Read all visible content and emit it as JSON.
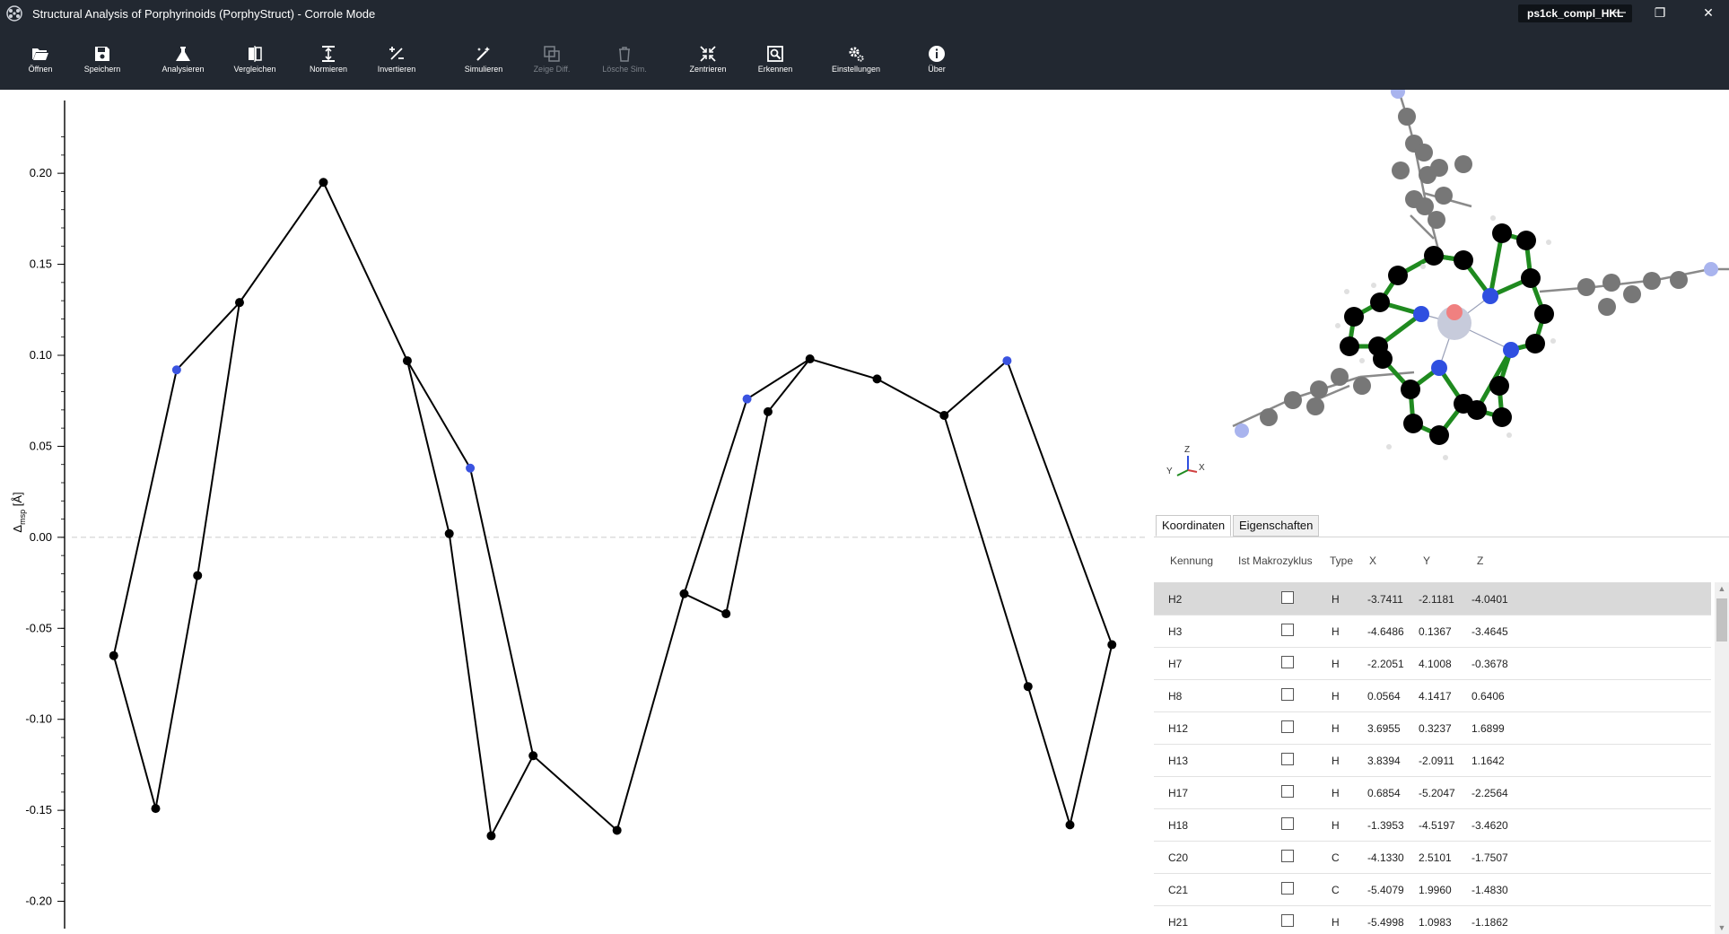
{
  "window": {
    "title": "Structural Analysis of Porphyrinoids (PorphyStruct) - Corrole Mode",
    "file_badge": "ps1ck_compl_HKL",
    "minimize": "—",
    "maximize": "❐",
    "close": "✕"
  },
  "toolbar": {
    "items": [
      {
        "label": "Öffnen",
        "icon": "folder-open-icon",
        "enabled": true
      },
      {
        "label": "Speichern",
        "icon": "save-icon",
        "enabled": true
      },
      {
        "label": "Analysieren",
        "icon": "flask-icon",
        "enabled": true
      },
      {
        "label": "Vergleichen",
        "icon": "compare-icon",
        "enabled": true
      },
      {
        "label": "Normieren",
        "icon": "normalize-icon",
        "enabled": true
      },
      {
        "label": "Invertieren",
        "icon": "invert-icon",
        "enabled": true
      },
      {
        "label": "Simulieren",
        "icon": "magic-wand-icon",
        "enabled": true
      },
      {
        "label": "Zeige Diff.",
        "icon": "diff-icon",
        "enabled": false
      },
      {
        "label": "Lösche Sim.",
        "icon": "trash-icon",
        "enabled": false
      },
      {
        "label": "Zentrieren",
        "icon": "center-icon",
        "enabled": true
      },
      {
        "label": "Erkennen",
        "icon": "detect-icon",
        "enabled": true
      },
      {
        "label": "Einstellungen",
        "icon": "gear-icon",
        "enabled": true
      },
      {
        "label": "Über",
        "icon": "info-icon",
        "enabled": true
      }
    ]
  },
  "chart_data": {
    "type": "line",
    "ylabel": "Δmsp [Å]",
    "ylabel_main": "Δ",
    "ylabel_sub": "msp",
    "ylabel_unit": " [Å]",
    "ylim": [
      -0.215,
      0.24
    ],
    "y_ticks": [
      "0.20",
      "0.15",
      "0.10",
      "0.05",
      "0.00",
      "-0.05",
      "-0.10",
      "-0.15",
      "-0.20"
    ],
    "y_tick_values": [
      0.2,
      0.15,
      0.1,
      0.05,
      0.0,
      -0.05,
      -0.1,
      -0.15,
      -0.2
    ],
    "zero_line": true,
    "colors": {
      "atom": "#000000",
      "nitrogen": "#3a53e0",
      "line": "#000000",
      "zero": "#cccccc"
    },
    "segments": [
      [
        [
          1,
          -0.065
        ],
        [
          2,
          -0.149
        ],
        [
          3,
          -0.021
        ],
        [
          4,
          0.129
        ],
        [
          6,
          0.195
        ],
        [
          8,
          0.097
        ],
        [
          9,
          0.002
        ],
        [
          10,
          -0.164
        ],
        [
          11,
          -0.12
        ],
        [
          13,
          -0.161
        ],
        [
          14.6,
          -0.031
        ],
        [
          15.6,
          -0.042
        ],
        [
          16.6,
          0.069
        ],
        [
          17.6,
          0.098
        ],
        [
          19.2,
          0.087
        ],
        [
          20.8,
          0.067
        ],
        [
          22.8,
          -0.082
        ],
        [
          23.8,
          -0.158
        ],
        [
          24.8,
          -0.059
        ]
      ],
      [
        [
          1,
          -0.065
        ],
        [
          2.5,
          0.092
        ],
        [
          4,
          0.129
        ]
      ],
      [
        [
          8,
          0.097
        ],
        [
          9.5,
          0.038
        ],
        [
          11,
          -0.12
        ]
      ],
      [
        [
          14.6,
          -0.031
        ],
        [
          16.1,
          0.076
        ],
        [
          17.6,
          0.098
        ]
      ],
      [
        [
          20.8,
          0.067
        ],
        [
          22.3,
          0.097
        ],
        [
          24.8,
          -0.059
        ]
      ]
    ],
    "points": [
      {
        "x": 1,
        "y": -0.065,
        "type": "C"
      },
      {
        "x": 2,
        "y": -0.149,
        "type": "C"
      },
      {
        "x": 2.5,
        "y": 0.092,
        "type": "N"
      },
      {
        "x": 3,
        "y": -0.021,
        "type": "C"
      },
      {
        "x": 4,
        "y": 0.129,
        "type": "C"
      },
      {
        "x": 6,
        "y": 0.195,
        "type": "C"
      },
      {
        "x": 8,
        "y": 0.097,
        "type": "C"
      },
      {
        "x": 9,
        "y": 0.002,
        "type": "C"
      },
      {
        "x": 9.5,
        "y": 0.038,
        "type": "N"
      },
      {
        "x": 10,
        "y": -0.164,
        "type": "C"
      },
      {
        "x": 11,
        "y": -0.12,
        "type": "C"
      },
      {
        "x": 13,
        "y": -0.161,
        "type": "C"
      },
      {
        "x": 14.6,
        "y": -0.031,
        "type": "C"
      },
      {
        "x": 15.6,
        "y": -0.042,
        "type": "C"
      },
      {
        "x": 16.1,
        "y": 0.076,
        "type": "N"
      },
      {
        "x": 16.6,
        "y": 0.069,
        "type": "C"
      },
      {
        "x": 17.6,
        "y": 0.098,
        "type": "C"
      },
      {
        "x": 19.2,
        "y": 0.087,
        "type": "C"
      },
      {
        "x": 20.8,
        "y": 0.067,
        "type": "C"
      },
      {
        "x": 22.3,
        "y": 0.097,
        "type": "N"
      },
      {
        "x": 22.8,
        "y": -0.082,
        "type": "C"
      },
      {
        "x": 23.8,
        "y": -0.158,
        "type": "C"
      },
      {
        "x": 24.8,
        "y": -0.059,
        "type": "C"
      }
    ]
  },
  "molecule_view": {
    "axes_labels": {
      "z": "Z",
      "y": "Y",
      "x": "X"
    },
    "colors": {
      "bond": "#1f8a1f",
      "carbon": "#000000",
      "nitrogen": "#2f4fe0",
      "metal": "#c0c4d6",
      "oxygen": "#f08080",
      "substituent": "#7a7a7a",
      "terminal": "#a9b4ee",
      "hydrogen": "#e8e8e8"
    }
  },
  "tabs": [
    {
      "label": "Koordinaten",
      "active": true
    },
    {
      "label": "Eigenschaften",
      "active": false
    }
  ],
  "table": {
    "headers": [
      "Kennung",
      "Ist Makrozyklus",
      "Type",
      "X",
      "Y",
      "Z"
    ],
    "rows": [
      {
        "id": "H2",
        "macro": false,
        "type": "H",
        "x": "-3.7411",
        "y": "-2.1181",
        "z": "-4.0401",
        "selected": true
      },
      {
        "id": "H3",
        "macro": false,
        "type": "H",
        "x": "-4.6486",
        "y": "0.1367",
        "z": "-3.4645"
      },
      {
        "id": "H7",
        "macro": false,
        "type": "H",
        "x": "-2.2051",
        "y": "4.1008",
        "z": "-0.3678"
      },
      {
        "id": "H8",
        "macro": false,
        "type": "H",
        "x": "0.0564",
        "y": "4.1417",
        "z": "0.6406"
      },
      {
        "id": "H12",
        "macro": false,
        "type": "H",
        "x": "3.6955",
        "y": "0.3237",
        "z": "1.6899"
      },
      {
        "id": "H13",
        "macro": false,
        "type": "H",
        "x": "3.8394",
        "y": "-2.0911",
        "z": "1.1642"
      },
      {
        "id": "H17",
        "macro": false,
        "type": "H",
        "x": "0.6854",
        "y": "-5.2047",
        "z": "-2.2564"
      },
      {
        "id": "H18",
        "macro": false,
        "type": "H",
        "x": "-1.3953",
        "y": "-4.5197",
        "z": "-3.4620"
      },
      {
        "id": "C20",
        "macro": false,
        "type": "C",
        "x": "-4.1330",
        "y": "2.5101",
        "z": "-1.7507"
      },
      {
        "id": "C21",
        "macro": false,
        "type": "C",
        "x": "-5.4079",
        "y": "1.9960",
        "z": "-1.4830"
      },
      {
        "id": "H21",
        "macro": false,
        "type": "H",
        "x": "-5.4998",
        "y": "1.0983",
        "z": "-1.1862"
      }
    ]
  }
}
